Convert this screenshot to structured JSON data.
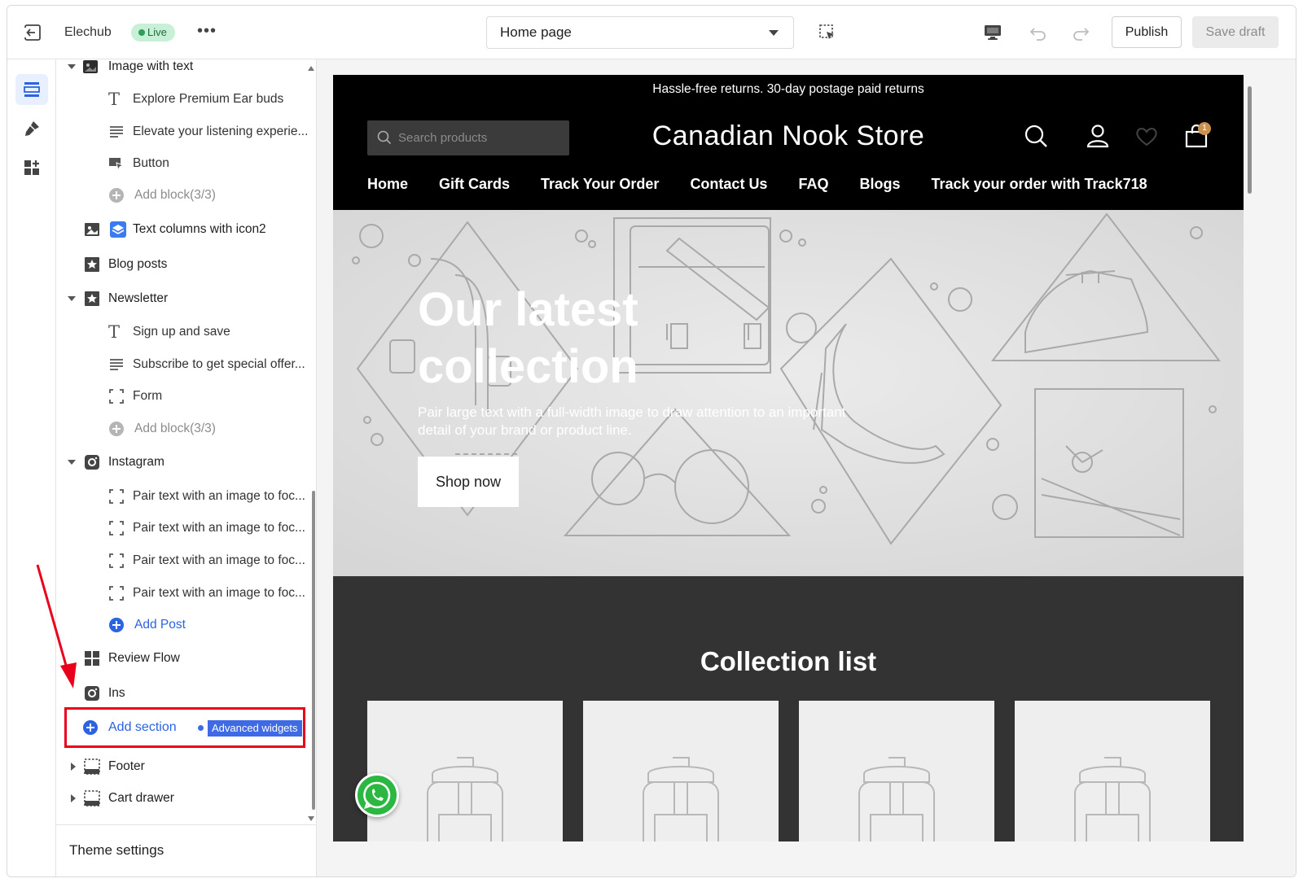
{
  "topbar": {
    "store_name": "Elechub",
    "live_badge": "Live",
    "more_label": "•••",
    "page_select": "Home page",
    "publish_label": "Publish",
    "save_draft_label": "Save draft"
  },
  "rail": {
    "icons": [
      "sections-icon",
      "theme-brush-icon",
      "apps-icon"
    ]
  },
  "sidebar": {
    "items": [
      {
        "label": "Image with text",
        "kind": "section",
        "icon": "image-icon"
      },
      {
        "label": "Explore Premium Ear buds",
        "kind": "block",
        "icon": "text-icon"
      },
      {
        "label": "Elevate your listening experie...",
        "kind": "block",
        "icon": "paragraph-icon"
      },
      {
        "label": "Button",
        "kind": "block",
        "icon": "button-icon"
      },
      {
        "label": "Add block(3/3)",
        "kind": "add-muted",
        "icon": "plus-circle-icon"
      },
      {
        "label": "Text columns with icon2",
        "kind": "section",
        "icon": "layers-icon"
      },
      {
        "label": "Blog posts",
        "kind": "section",
        "icon": "star-bookmark-icon"
      },
      {
        "label": "Newsletter",
        "kind": "section",
        "icon": "star-bookmark-icon"
      },
      {
        "label": "Sign up and save",
        "kind": "block",
        "icon": "text-icon"
      },
      {
        "label": "Subscribe to get special offer...",
        "kind": "block",
        "icon": "paragraph-icon"
      },
      {
        "label": "Form",
        "kind": "block",
        "icon": "frame-icon"
      },
      {
        "label": "Add block(3/3)",
        "kind": "add-muted",
        "icon": "plus-circle-icon"
      },
      {
        "label": "Instagram",
        "kind": "section",
        "icon": "instagram-icon"
      },
      {
        "label": "Pair text with an image to foc...",
        "kind": "block",
        "icon": "frame-icon"
      },
      {
        "label": "Pair text with an image to foc...",
        "kind": "block",
        "icon": "frame-icon"
      },
      {
        "label": "Pair text with an image to foc...",
        "kind": "block",
        "icon": "frame-icon"
      },
      {
        "label": "Pair text with an image to foc...",
        "kind": "block",
        "icon": "frame-icon"
      },
      {
        "label": "Add Post",
        "kind": "add-blue",
        "icon": "plus-circle-icon"
      },
      {
        "label": "Review Flow",
        "kind": "section",
        "icon": "grid-icon"
      },
      {
        "label": "Ins",
        "kind": "section",
        "icon": "instagram-icon"
      },
      {
        "label": "Add section",
        "kind": "add-section",
        "icon": "plus-circle-icon"
      },
      {
        "label": "Footer",
        "kind": "section",
        "icon": "footer-icon"
      },
      {
        "label": "Cart drawer",
        "kind": "section",
        "icon": "footer-icon"
      }
    ],
    "advanced_widgets": "Advanced widgets",
    "theme_settings": "Theme settings"
  },
  "store": {
    "announcement": "Hassle-free returns. 30-day postage paid returns",
    "search_placeholder": "Search products",
    "name": "Canadian Nook Store",
    "cart_count": "1",
    "nav": [
      "Home",
      "Gift Cards",
      "Track Your Order",
      "Contact Us",
      "FAQ",
      "Blogs",
      "Track your order with Track718"
    ],
    "hero": {
      "title": "Our latest collection",
      "subtitle": "Pair large text with a full-width image to draw attention to an important detail of your brand or product line.",
      "button": "Shop now"
    },
    "collection_title": "Collection list"
  },
  "colors": {
    "accent": "#2b63e0",
    "highlight": "#e8001c",
    "live": "#2e9e5b",
    "header": "#000000",
    "collection_bg": "#333333"
  }
}
